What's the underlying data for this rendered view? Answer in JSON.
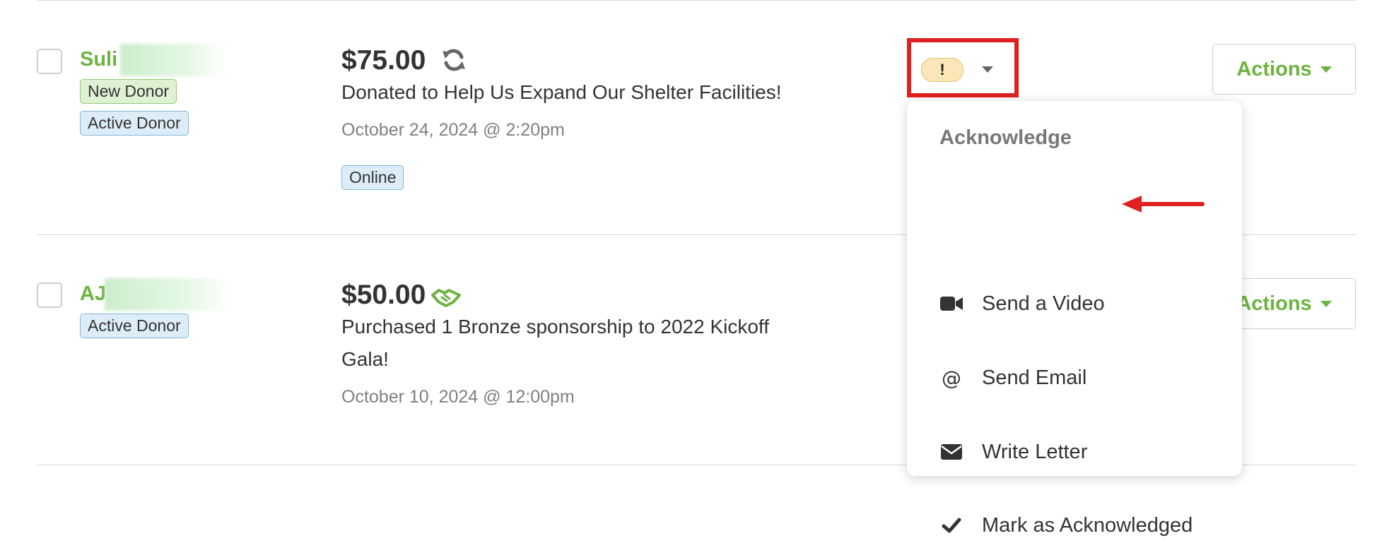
{
  "rows": [
    {
      "name": "Suli",
      "badges": [
        "New Donor",
        "Active Donor"
      ],
      "amount": "$75.00",
      "description": "Donated to Help Us Expand Our Shelter Facilities!",
      "date": "October 24, 2024 @ 2:20pm",
      "channel": "Online",
      "amount_icon": "recurring-icon",
      "actions_label": "Actions"
    },
    {
      "name": "AJ",
      "badges": [
        "Active Donor"
      ],
      "amount": "$50.00",
      "description_line1": "Purchased 1 Bronze sponsorship to 2022 Kickoff",
      "description_line2": "Gala!",
      "date": "October 10, 2024 @ 12:00pm",
      "amount_icon": "handshake-icon",
      "actions_label": "Actions"
    }
  ],
  "ack_status": {
    "badge": "!"
  },
  "menu": {
    "heading": "Acknowledge",
    "items": [
      {
        "label": "Send a Video",
        "icon": "video-camera-icon"
      },
      {
        "label": "Send Email",
        "icon": "at-icon"
      },
      {
        "label": "Write Letter",
        "icon": "envelope-icon"
      },
      {
        "label": "Mark as Acknowledged",
        "icon": "check-icon"
      }
    ]
  },
  "colors": {
    "accent_green": "#6cb33f",
    "highlight_red": "#e02020",
    "badge_green_bg": "#dff1d3",
    "badge_blue_bg": "#dcedf8",
    "warning_pill": "#fbe6b8"
  }
}
